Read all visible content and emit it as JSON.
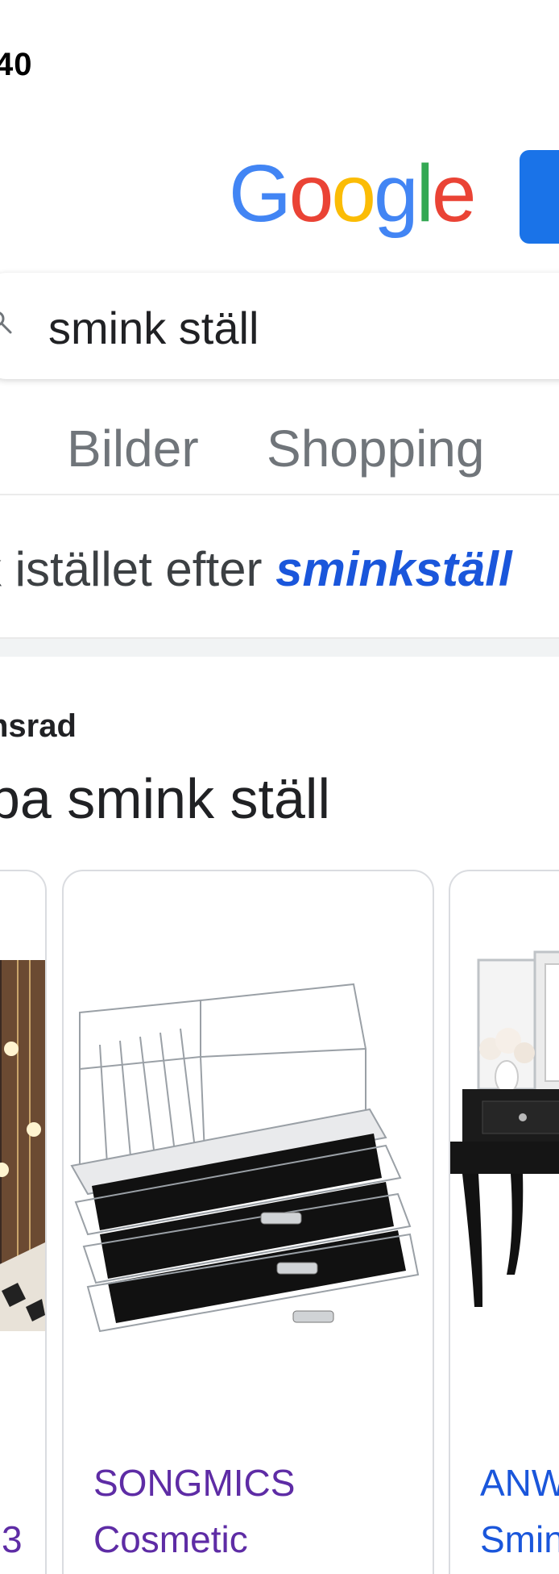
{
  "status_bar": {
    "time": "40"
  },
  "header": {
    "logo": {
      "letters": [
        "G",
        "o",
        "o",
        "g",
        "l",
        "e"
      ],
      "colors": [
        "#4285F4",
        "#EA4335",
        "#FBBC05",
        "#4285F4",
        "#34A853",
        "#EA4335"
      ]
    },
    "signin_color": "#1a73e8"
  },
  "search": {
    "query": "smink ställ",
    "icon": "search-icon"
  },
  "tabs": {
    "active_fragment": "t",
    "items": [
      {
        "label": "Bilder"
      },
      {
        "label": "Shopping"
      }
    ]
  },
  "spelling": {
    "prefix": "k istället efter ",
    "suggestion": "sminkställ"
  },
  "ads": {
    "label": "nsrad",
    "heading": "pa smink ställ"
  },
  "products": [
    {
      "brand": "",
      "title": "3"
    },
    {
      "brand": "SONGMICS",
      "title": "Cosmetic"
    },
    {
      "brand": "ANW",
      "title": "Smin"
    }
  ]
}
